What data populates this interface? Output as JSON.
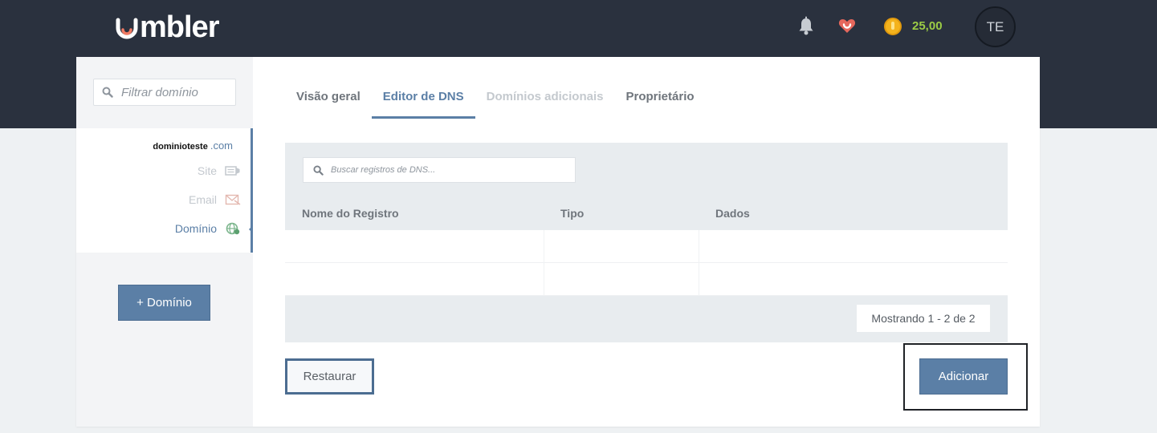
{
  "brand": {
    "logo_text": "mbler"
  },
  "header": {
    "credits": "25,00",
    "avatar_initials": "TE"
  },
  "sidebar": {
    "filter_placeholder": "Filtrar domínio",
    "domain": {
      "name": "dominioteste",
      "tld": ".com"
    },
    "items": [
      {
        "label": "Site",
        "icon": "site-icon"
      },
      {
        "label": "Email",
        "icon": "email-icon"
      },
      {
        "label": "Domínio",
        "icon": "globe-icon",
        "active": true
      }
    ],
    "add_domain_label": "+ Domínio"
  },
  "tabs": [
    {
      "label": "Visão geral",
      "state": "normal"
    },
    {
      "label": "Editor de DNS",
      "state": "active"
    },
    {
      "label": "Domínios adicionais",
      "state": "disabled"
    },
    {
      "label": "Proprietário",
      "state": "normal"
    }
  ],
  "dns": {
    "search_placeholder": "Buscar registros de DNS...",
    "columns": [
      "Nome do Registro",
      "Tipo",
      "Dados"
    ],
    "rows": [
      {
        "name": "",
        "type": "",
        "data": ""
      },
      {
        "name": "",
        "type": "",
        "data": ""
      }
    ],
    "pagination": "Mostrando 1 - 2 de 2"
  },
  "actions": {
    "restore_label": "Restaurar",
    "add_label": "Adicionar"
  },
  "colors": {
    "accent": "#5b7fa6",
    "topbar": "#2a313e",
    "credits": "#9ccc45",
    "logo_accent": "#f07a63"
  }
}
